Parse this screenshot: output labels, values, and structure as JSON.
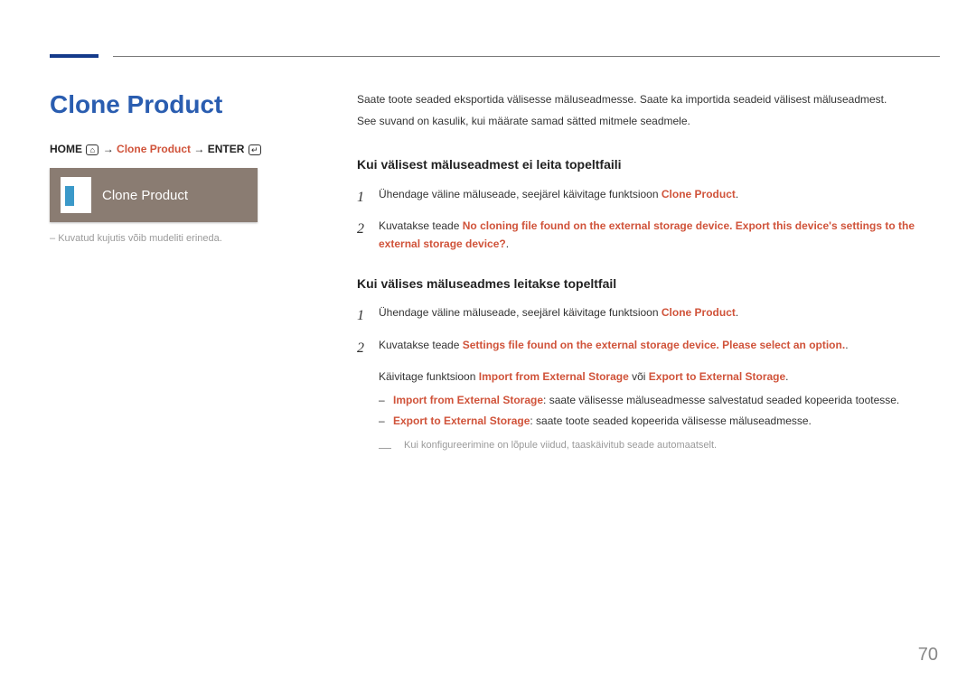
{
  "title": "Clone Product",
  "breadcrumb": {
    "home": "HOME",
    "arrow1": " → ",
    "item": "Clone Product",
    "arrow2": " → ",
    "enter": "ENTER"
  },
  "thumb_label": "Clone Product",
  "left_note": "Kuvatud kujutis võib mudeliti erineda.",
  "intro1": "Saate toote seaded eksportida välisesse mäluseadmesse. Saate ka importida seadeid välisest mäluseadmest.",
  "intro2": "See suvand on kasulik, kui määrate samad sätted mitmele seadmele.",
  "section1": {
    "heading": "Kui välisest mäluseadmest ei leita topeltfaili",
    "step1_prefix": "Ühendage väline mäluseade, seejärel käivitage funktsioon ",
    "step1_hl": "Clone Product",
    "step1_suffix": ".",
    "step2_prefix": "Kuvatakse teade ",
    "step2_hl": "No cloning file found on the external storage device. Export this device's settings to the external storage device?",
    "step2_suffix": "."
  },
  "section2": {
    "heading": "Kui välises mäluseadmes leitakse topeltfail",
    "step1_prefix": "Ühendage väline mäluseade, seejärel käivitage funktsioon ",
    "step1_hl": "Clone Product",
    "step1_suffix": ".",
    "step2_prefix": "Kuvatakse teade ",
    "step2_hl": "Settings file found on the external storage device. Please select an option.",
    "step2_suffix": ".",
    "sub_prefix": "Käivitage funktsioon ",
    "sub_hl1": "Import from External Storage",
    "sub_mid": " või ",
    "sub_hl2": "Export to External Storage",
    "sub_suffix": ".",
    "dash1_hl": "Import from External Storage",
    "dash1_text": ": saate välisesse mäluseadmesse salvestatud seaded kopeerida tootesse.",
    "dash2_hl": "Export to External Storage",
    "dash2_text": ": saate toote seaded kopeerida välisesse mäluseadmesse.",
    "final_note": "Kui konfigureerimine on lõpule viidud, taaskäivitub seade automaatselt."
  },
  "page_number": "70"
}
